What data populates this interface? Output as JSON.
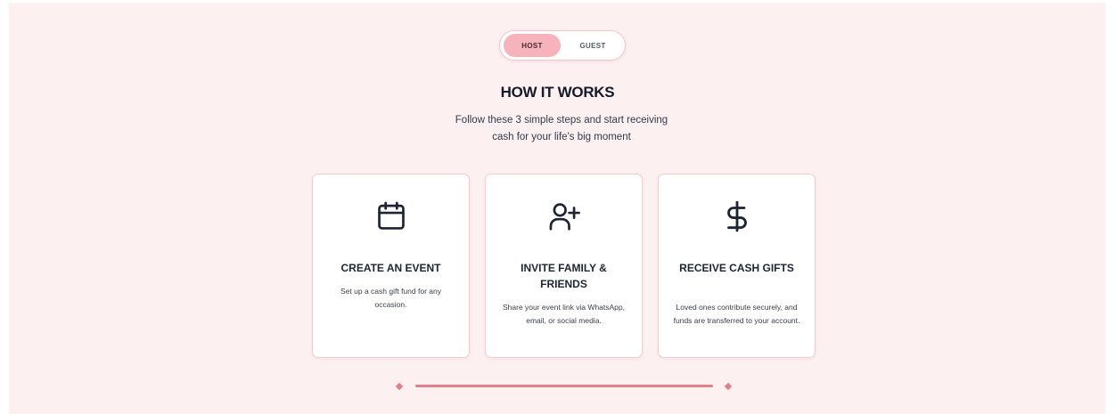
{
  "toggle": {
    "host_label": "HOST",
    "guest_label": "GUEST",
    "active": "HOST"
  },
  "section": {
    "title": "HOW IT WORKS",
    "subtitle_line1": "Follow these 3 simple steps and start receiving",
    "subtitle_line2": "cash for your life's big moment"
  },
  "steps": [
    {
      "icon": "calendar-icon",
      "title": "CREATE AN EVENT",
      "description": "Set up a cash gift fund for any occasion."
    },
    {
      "icon": "user-plus-icon",
      "title": "INVITE FAMILY & FRIENDS",
      "description": "Share your event link via WhatsApp, email, or social media."
    },
    {
      "icon": "dollar-icon",
      "title": "RECEIVE CASH GIFTS",
      "description": "Loved ones contribute securely, and funds are transferred to your account."
    }
  ],
  "colors": {
    "background": "#fdf0f1",
    "accent": "#f7b3bc",
    "divider": "#e27f8c",
    "text_dark": "#141a2a"
  }
}
